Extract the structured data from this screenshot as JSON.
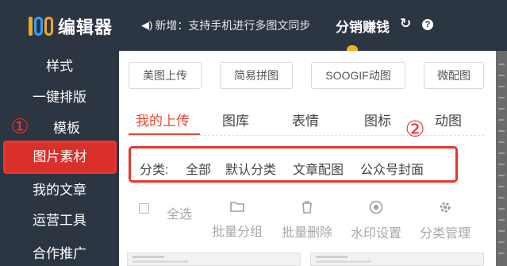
{
  "app": {
    "logo_text": "编辑器",
    "news_text": "新增：支持手机进行多图文同步",
    "fenxiao_label": "分销赚钱",
    "refresh_icon": "↻",
    "help_icon": "?",
    "speaker_icon": "◀)"
  },
  "sidebar": {
    "items": [
      {
        "label": "样式"
      },
      {
        "label": "一键排版"
      },
      {
        "label": "模板"
      },
      {
        "label": "图片素材"
      },
      {
        "label": "我的文章"
      },
      {
        "label": "运营工具"
      },
      {
        "label": "合作推广"
      }
    ],
    "active_index": 3,
    "annotation_1": "①"
  },
  "toolbar": {
    "buttons": [
      {
        "label": "美图上传"
      },
      {
        "label": "简易拼图"
      },
      {
        "label": "SOOGIF动图"
      },
      {
        "label": "微配图"
      }
    ]
  },
  "tabs": [
    {
      "label": "我的上传"
    },
    {
      "label": "图库"
    },
    {
      "label": "表情"
    },
    {
      "label": "图标"
    },
    {
      "label": "动图"
    }
  ],
  "annotation_2": "②",
  "categories": {
    "prefix": "分类:",
    "items": [
      "全部",
      "默认分类",
      "文章配图",
      "公众号封面"
    ]
  },
  "actions": {
    "select_all": "全选",
    "items": [
      {
        "label": "批量分组",
        "icon": "folder-icon"
      },
      {
        "label": "批量删除",
        "icon": "trash-icon"
      },
      {
        "label": "水印设置",
        "icon": "watermark-icon"
      },
      {
        "label": "分类管理",
        "icon": "gear-icon"
      }
    ]
  },
  "colors": {
    "sidebar_bg": "#2c3542",
    "active_item": "#d9302a",
    "accent": "#e8472f",
    "annotation_red": "#e8362f"
  }
}
